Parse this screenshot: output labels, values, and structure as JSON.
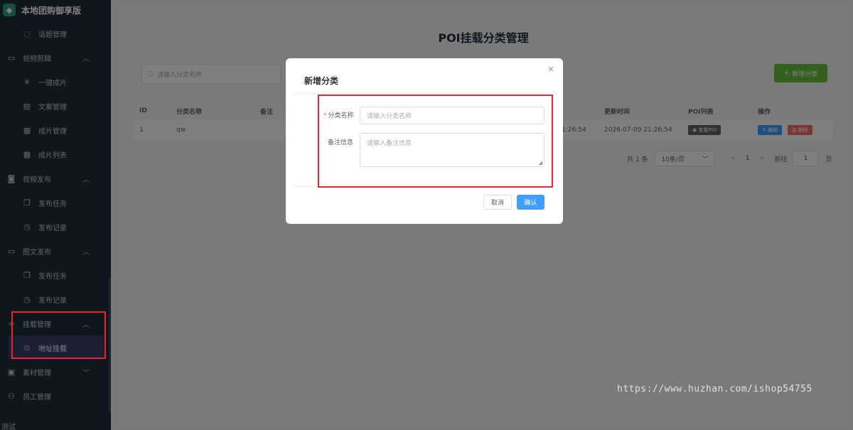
{
  "sidebar": {
    "brand": "本地团购御享版",
    "items": [
      {
        "label": "话题管理",
        "icon": "chat-icon",
        "type": "child"
      },
      {
        "label": "视频剪辑",
        "icon": "video-icon",
        "type": "group",
        "chevron": "^"
      },
      {
        "label": "一键成片",
        "icon": "sparkle-icon",
        "type": "child"
      },
      {
        "label": "文案管理",
        "icon": "document-icon",
        "type": "child"
      },
      {
        "label": "成片管理",
        "icon": "film-icon",
        "type": "child"
      },
      {
        "label": "成片列表",
        "icon": "grid-icon",
        "type": "child"
      },
      {
        "label": "视频发布",
        "icon": "camera-icon",
        "type": "group",
        "chevron": "^"
      },
      {
        "label": "发布任务",
        "icon": "copy-icon",
        "type": "child"
      },
      {
        "label": "发布记录",
        "icon": "clock-icon",
        "type": "child"
      },
      {
        "label": "图文发布",
        "icon": "folder-icon",
        "type": "group",
        "chevron": "^"
      },
      {
        "label": "发布任务",
        "icon": "copy-icon",
        "type": "child"
      },
      {
        "label": "发布记录",
        "icon": "clock-icon",
        "type": "child"
      },
      {
        "label": "挂载管理",
        "icon": "link-icon",
        "type": "group",
        "chevron": "^"
      },
      {
        "label": "地址挂载",
        "icon": "location-icon",
        "type": "child",
        "active": true
      },
      {
        "label": "素材管理",
        "icon": "image-icon",
        "type": "group",
        "chevron": "v"
      },
      {
        "label": "员工管理",
        "icon": "user-icon",
        "type": "group"
      }
    ],
    "bottom": "测试"
  },
  "main": {
    "title": "POI挂载分类管理",
    "search_placeholder": "请输入分类名称",
    "add_button": "新增分类",
    "table": {
      "headers": [
        "ID",
        "分类名称",
        "备注",
        "",
        "更新时间",
        "POI列表",
        "操作"
      ],
      "rows": [
        {
          "id": "1",
          "name": "qw",
          "note": "",
          "created_partial": "1:26:54",
          "updated": "2026-07-09 21:26:54",
          "poi_btn": "查看POI",
          "edit_btn": "编辑",
          "delete_btn": "删除"
        }
      ]
    },
    "pagination": {
      "total": "共 1 条",
      "page_size": "10条/页",
      "prev": "<",
      "current": "1",
      "next": ">",
      "goto_label": "前往",
      "goto_value": "1",
      "page_suffix": "页"
    }
  },
  "dialog": {
    "title": "新增分类",
    "close": "×",
    "name_label": "分类名称",
    "required_mark": "*",
    "name_placeholder": "请输入分类名称",
    "note_label": "备注信息",
    "note_placeholder": "请输入备注信息",
    "cancel": "取消",
    "confirm": "确认"
  },
  "watermark": "https://www.huzhan.com/ishop54755",
  "colors": {
    "sidebar_bg": "#1f2d3d",
    "primary": "#409eff",
    "success": "#67c23a",
    "danger": "#f56c6c",
    "annotation": "#e8262d"
  }
}
